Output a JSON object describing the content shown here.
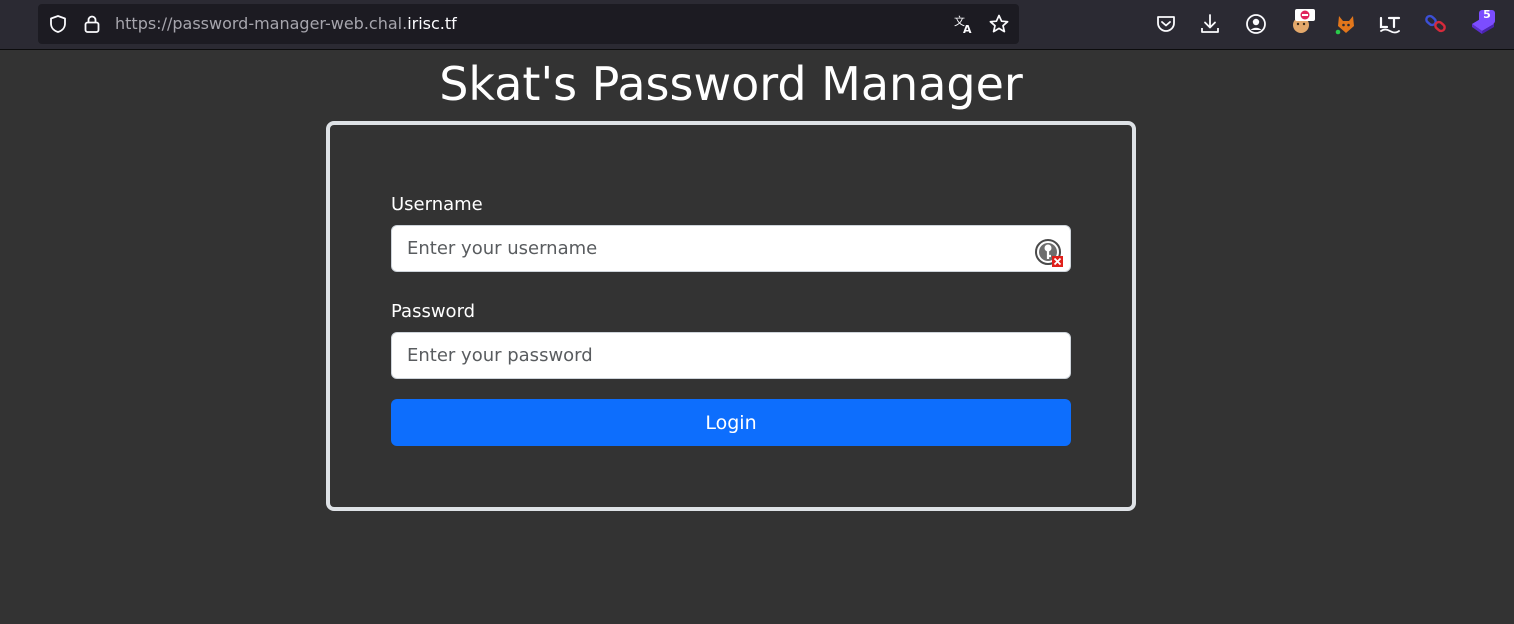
{
  "browser": {
    "url_prefix": "https://password-manager-web.chal.",
    "url_domain": "irisc.tf",
    "extension_badge": "5",
    "toolbar_icons": [
      "shield-icon",
      "lock-icon",
      "translate-icon",
      "star-icon",
      "pocket-icon",
      "download-icon",
      "account-icon",
      "extension-icons"
    ]
  },
  "page": {
    "title": "Skat's Password Manager"
  },
  "form": {
    "username_label": "Username",
    "username_placeholder": "Enter your username",
    "username_value": "",
    "password_label": "Password",
    "password_placeholder": "Enter your password",
    "password_value": "",
    "login_label": "Login"
  },
  "colors": {
    "background": "#333333",
    "card_border": "#dee2e6",
    "button": "#0d6efd",
    "toolbar": "#2b2a33",
    "urlbar": "#1c1b22"
  }
}
